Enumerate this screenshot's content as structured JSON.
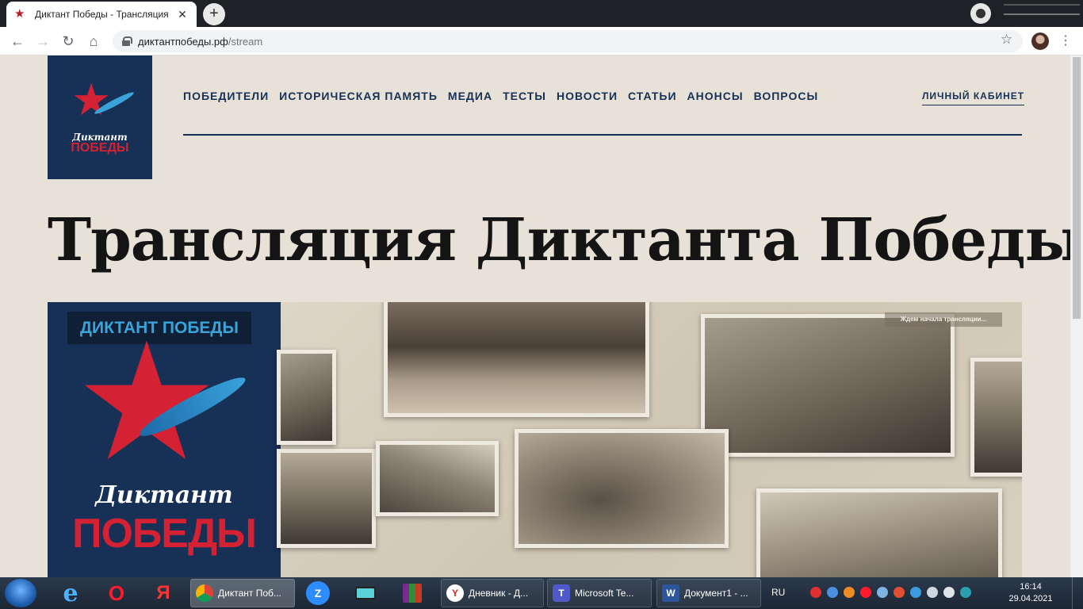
{
  "browser": {
    "tab_title": "Диктант Победы - Трансляция",
    "tab_close": "✕",
    "new_tab": "+",
    "url_host": "диктантпобеды.рф",
    "url_path": "/stream",
    "back": "←",
    "forward": "→",
    "reload": "↻",
    "home": "⌂",
    "bookmark": "☆",
    "menu": "⋮"
  },
  "site": {
    "logo": {
      "line1": "Диктант",
      "line2": "ПОБЕДЫ"
    },
    "nav": [
      {
        "label": "ПОБЕДИТЕЛИ"
      },
      {
        "label": "ИСТОРИЧЕСКАЯ ПАМЯТЬ"
      },
      {
        "label": "МЕДИА"
      },
      {
        "label": "ТЕСТЫ"
      },
      {
        "label": "НОВОСТИ"
      },
      {
        "label": "СТАТЬИ"
      },
      {
        "label": "АНОНСЫ"
      },
      {
        "label": "ВОПРОСЫ"
      }
    ],
    "cabinet": "ЛИЧНЫЙ КАБИНЕТ",
    "title": "Трансляция Диктанта Победы"
  },
  "player": {
    "badge": "ДИКТАНТ ПОБЕДЫ",
    "brand_line1": "Диктант",
    "brand_line2": "ПОБЕДЫ",
    "waiting": "Ждем начала трансляции..."
  },
  "taskbar": {
    "tasks": [
      {
        "label": "Диктант Поб..."
      },
      {
        "label": "Дневник - Д..."
      },
      {
        "label": "Microsoft Te..."
      },
      {
        "label": "Документ1 - ..."
      }
    ],
    "pinned": {
      "ie": "e",
      "opera": "O",
      "yandex": "Я",
      "zoom": "Z",
      "yandex_task": "Y",
      "teams_task": "T",
      "word_task": "W"
    },
    "lang": "RU",
    "time": "16:14",
    "date": "29.04.2021"
  },
  "colors": {
    "navy": "#173055",
    "red": "#d42134",
    "blue": "#3aa3da",
    "page_bg": "#e7e1d8"
  }
}
